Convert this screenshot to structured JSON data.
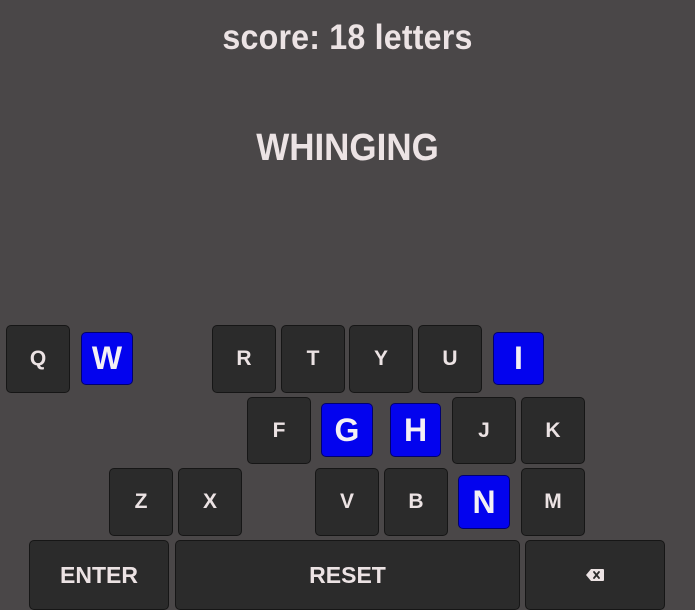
{
  "score_text": "score: 18 letters",
  "current_word": "WHINGING",
  "keyboard": {
    "letters": {
      "Q": "Q",
      "W": "W",
      "R": "R",
      "T": "T",
      "Y": "Y",
      "U": "U",
      "I": "I",
      "F": "F",
      "G": "G",
      "H": "H",
      "J": "J",
      "K": "K",
      "Z": "Z",
      "X": "X",
      "V": "V",
      "B": "B",
      "N": "N",
      "M": "M"
    },
    "used_letters": [
      "W",
      "I",
      "G",
      "H",
      "N"
    ],
    "enter_label": "ENTER",
    "reset_label": "RESET",
    "backspace_icon": "backspace-icon"
  },
  "colors": {
    "background": "#4a4748",
    "key": "#2b2b2b",
    "used_key": "#0303ee",
    "text": "#ece3e4"
  }
}
